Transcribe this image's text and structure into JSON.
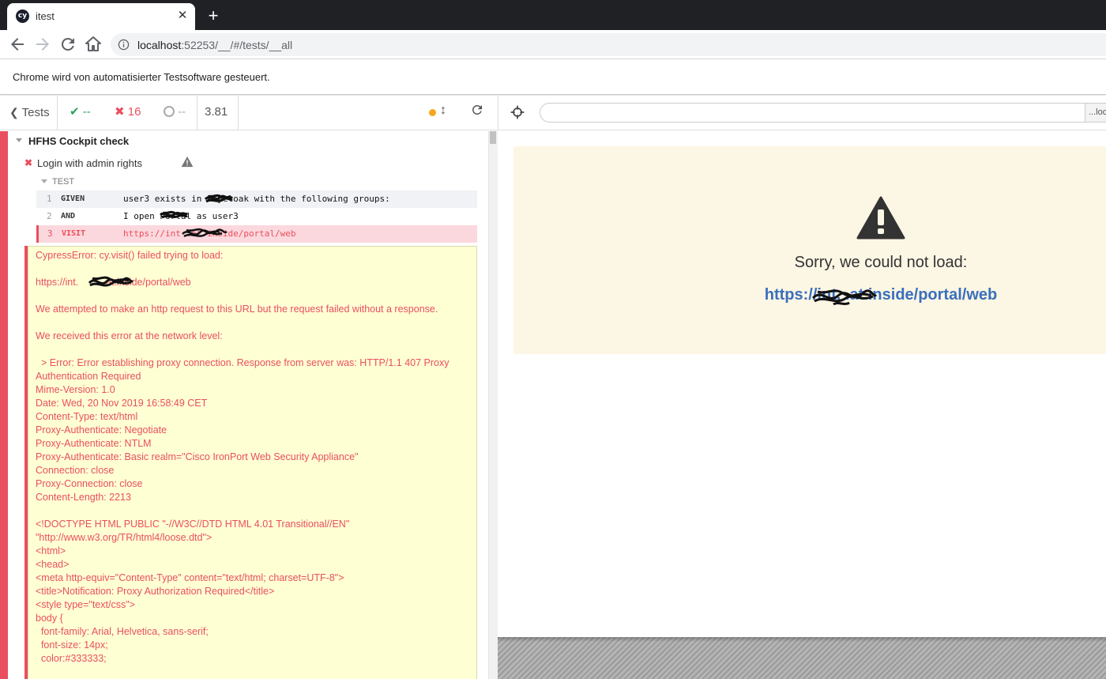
{
  "browser": {
    "tab_title": "itest",
    "tab_favicon": "cy",
    "url_host": "localhost",
    "url_rest": ":52253/__/#/tests/__all",
    "infobar_text": "Chrome wird von automatisierter Testsoftware gesteuert."
  },
  "reporter": {
    "tests_label": "Tests",
    "passed": "--",
    "failed": "16",
    "pending": "--",
    "duration": "3.81",
    "suite_title": "HFHS Cockpit check",
    "test_title": "Login with admin rights",
    "section_label": "TEST",
    "commands": [
      {
        "num": "1",
        "name": "GIVEN",
        "msg": "user3 exists in      keycloak with the following groups:"
      },
      {
        "num": "2",
        "name": "AND",
        "msg": "I open       Portal as user3"
      },
      {
        "num": "3",
        "name": "VISIT",
        "msg": "https://int         .at.inside/portal/web"
      }
    ],
    "error_text": "CypressError: cy.visit() failed trying to load:\n\nhttps://int.          at.inside/portal/web\n\nWe attempted to make an http request to this URL but the request failed without a response.\n\nWe received this error at the network level:\n\n  > Error: Error establishing proxy connection. Response from server was: HTTP/1.1 407 Proxy Authentication Required\nMime-Version: 1.0\nDate: Wed, 20 Nov 2019 16:58:49 CET\nContent-Type: text/html\nProxy-Authenticate: Negotiate\nProxy-Authenticate: NTLM\nProxy-Authenticate: Basic realm=\"Cisco IronPort Web Security Appliance\"\nConnection: close\nProxy-Connection: close\nContent-Length: 2213\n\n<!DOCTYPE HTML PUBLIC \"-//W3C//DTD HTML 4.01 Transitional//EN\"\n\"http://www.w3.org/TR/html4/loose.dtd\">\n<html>\n<head>\n<meta http-equiv=\"Content-Type\" content=\"text/html; charset=UTF-8\">\n<title>Notification: Proxy Authorization Required</title>\n<style type=\"text/css\">\nbody {\n  font-family: Arial, Helvetica, sans-serif;\n  font-size: 14px;\n  color:#333333;"
  },
  "aut": {
    "url_suffix": "...loc",
    "error_message": "Sorry, we could not load:",
    "error_link": "https://int.          .at.inside/portal/web"
  },
  "colors": {
    "fail": "#e94f5f",
    "pass": "#2aa45a",
    "pending": "#f7a61c",
    "link": "#3a6fbd"
  }
}
